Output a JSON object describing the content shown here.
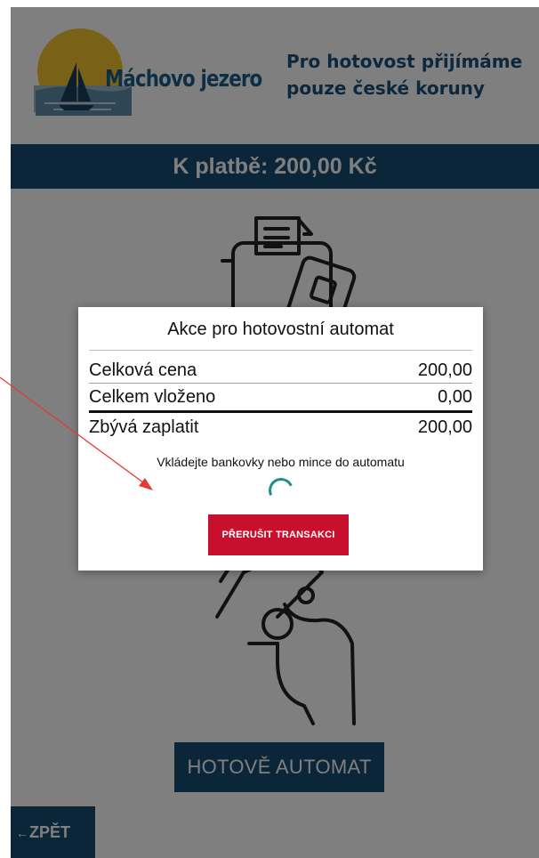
{
  "header": {
    "logo_text": "Máchovo jezero",
    "notice": "Pro hotovost přijímáme\npouze české koruny"
  },
  "payment_bar": {
    "label": "K platbě: 200,00 Kč"
  },
  "buttons": {
    "cash_machine": "HOTOVĚ AUTOMAT",
    "back_label": "ZPĚT",
    "back_arrow": "←"
  },
  "dialog": {
    "title": "Akce pro hotovostní automat",
    "rows": [
      {
        "label": "Celková cena",
        "value": "200,00"
      },
      {
        "label": "Celkem vloženo",
        "value": "0,00"
      },
      {
        "label": "Zbývá zaplatit",
        "value": "200,00"
      }
    ],
    "hint": "Vkládejte bankovky nebo mince do automatu",
    "abort_label": "PŘERUŠIT TRANSAKCI"
  },
  "colors": {
    "primary": "#174a73",
    "abort": "#c8102e",
    "spinner": "#1e8f8a",
    "annotation": "#e53935"
  },
  "icons": {
    "logo": "sun-sailboat-logo",
    "spinner": "loading-spinner",
    "illustration": "payment-terminal-cash-hand"
  }
}
